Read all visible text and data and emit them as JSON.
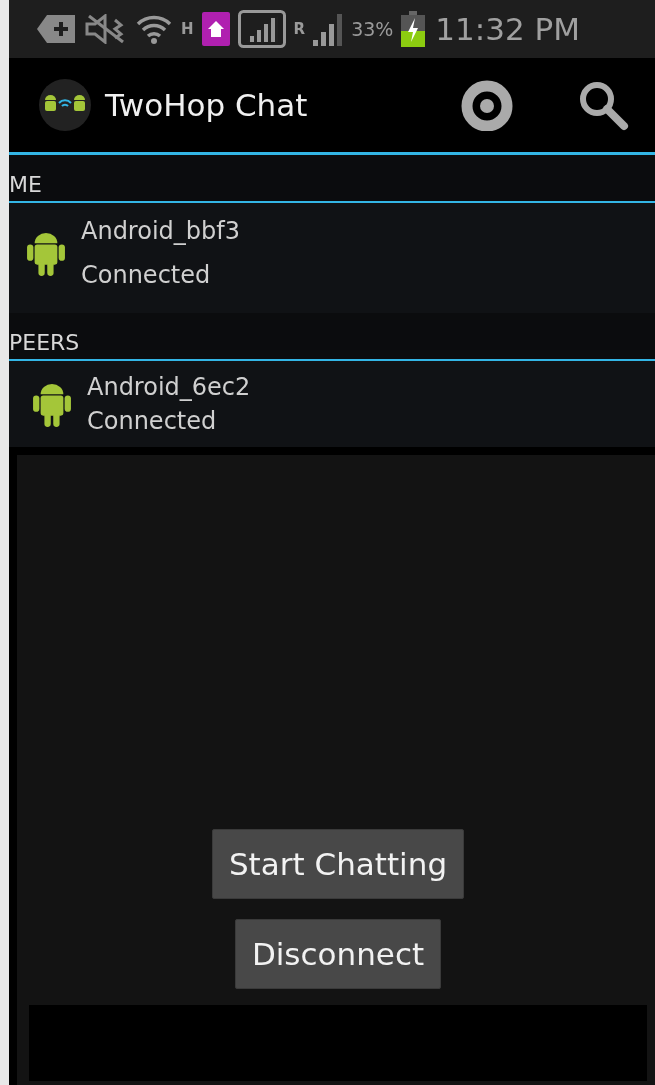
{
  "status_bar": {
    "network_letter": "H",
    "roaming_letter": "R",
    "battery": "33%",
    "time": "11:32 PM"
  },
  "action_bar": {
    "title": "TwoHop Chat"
  },
  "sections": [
    {
      "header": "ME",
      "devices": [
        {
          "name": "Android_bbf3",
          "status": "Connected"
        }
      ]
    },
    {
      "header": "PEERS",
      "devices": [
        {
          "name": "Android_6ec2",
          "status": "Connected"
        }
      ]
    }
  ],
  "buttons": [
    "Start Chatting",
    "Disconnect"
  ]
}
